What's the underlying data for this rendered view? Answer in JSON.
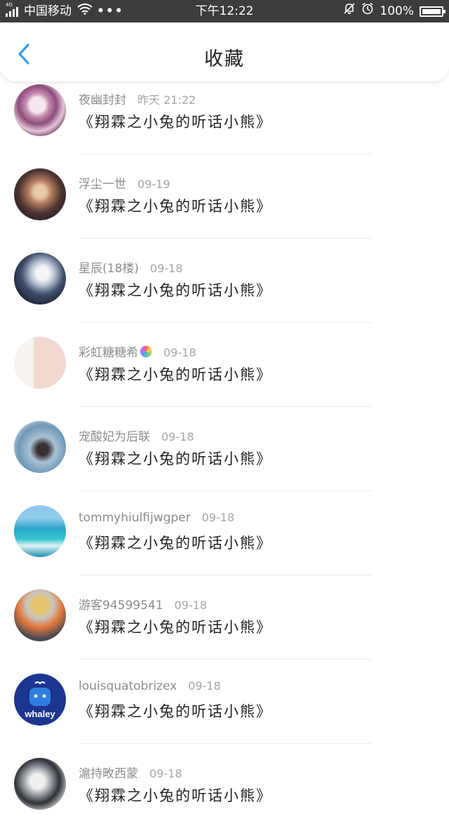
{
  "status_bar": {
    "network": "4G",
    "carrier": "中国移动",
    "time": "下午12:22",
    "battery": "100%"
  },
  "header": {
    "title": "收藏"
  },
  "items": [
    {
      "user": "夜幽封封",
      "time": "昨天 21:22",
      "content": "《翔霖之小兔的听话小熊》"
    },
    {
      "user": "浮尘一世",
      "time": "09-19",
      "content": "《翔霖之小兔的听话小熊》"
    },
    {
      "user": "星辰(18楼)",
      "time": "09-18",
      "content": "《翔霖之小兔的听话小熊》"
    },
    {
      "user": "彩虹糖糖希",
      "time": "09-18",
      "content": "《翔霖之小兔的听话小熊》"
    },
    {
      "user": "宠酸妃为后联",
      "time": "09-18",
      "content": "《翔霖之小兔的听话小熊》"
    },
    {
      "user": "tommyhiulfijwgper",
      "time": "09-18",
      "content": "《翔霖之小兔的听话小熊》"
    },
    {
      "user": "游客94599541",
      "time": "09-18",
      "content": "《翔霖之小兔的听话小熊》"
    },
    {
      "user": "louisquatobrizex",
      "time": "09-18",
      "content": "《翔霖之小兔的听话小熊》"
    },
    {
      "user": "滬持畋西蒙",
      "time": "09-18",
      "content": "《翔霖之小兔的听话小熊》"
    }
  ]
}
